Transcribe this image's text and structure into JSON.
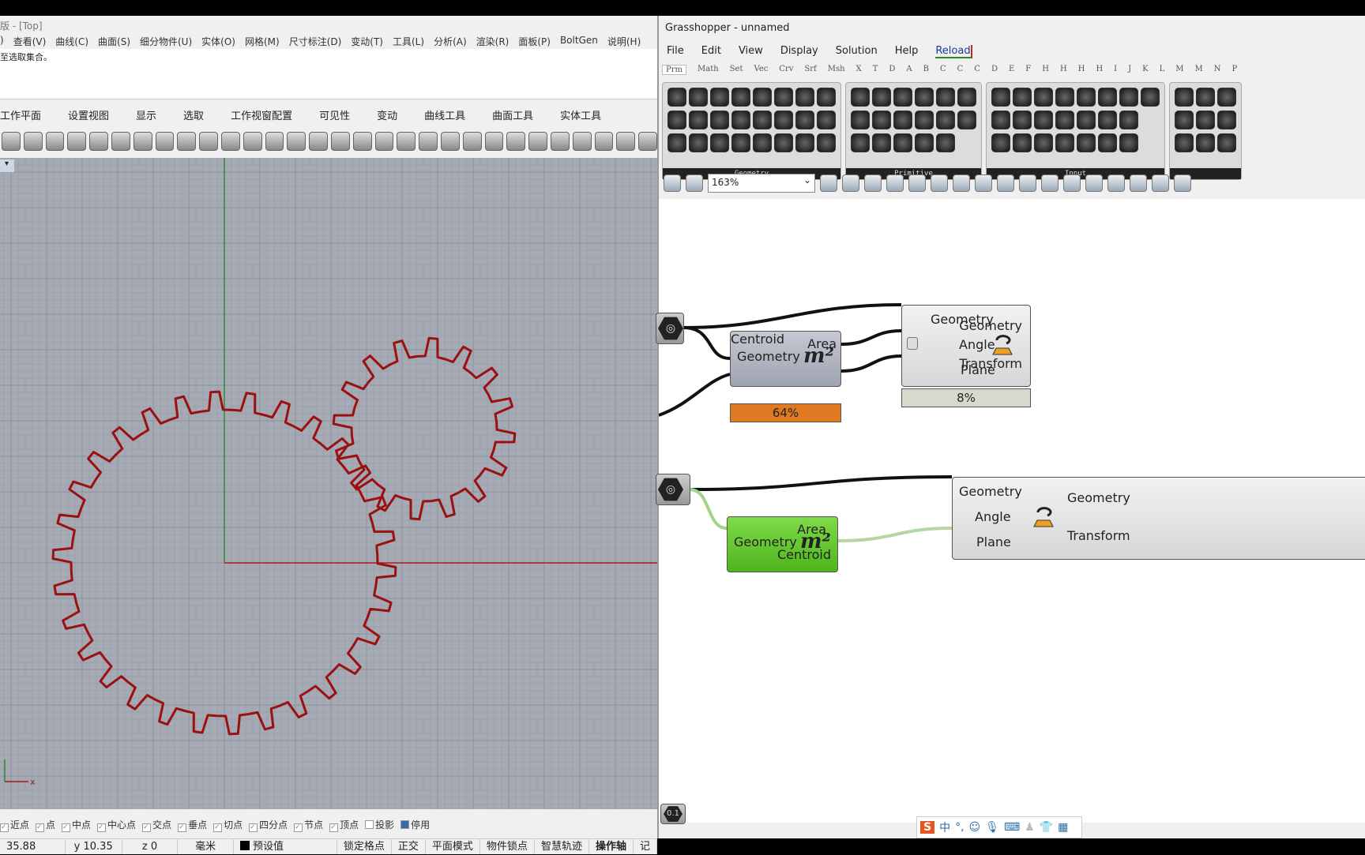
{
  "rhino": {
    "title": "版 - [Top]",
    "menu": [
      ")",
      "查看(V)",
      "曲线(C)",
      "曲面(S)",
      "细分物件(U)",
      "实体(O)",
      "网格(M)",
      "尺寸标注(D)",
      "变动(T)",
      "工具(L)",
      "分析(A)",
      "渲染(R)",
      "面板(P)",
      "BoltGen",
      "说明(H)"
    ],
    "command_text": "至选取集合。",
    "tabs": [
      "工作平面",
      "设置视图",
      "显示",
      "选取",
      "工作视窗配置",
      "可见性",
      "变动",
      "曲线工具",
      "曲面工具",
      "实体工具"
    ],
    "toolbar_icons": [
      "print-icon",
      "new-icon",
      "cut-icon",
      "copy-icon",
      "paste-icon",
      "undo-icon",
      "pan-icon",
      "rotate-view-icon",
      "zoom-icon",
      "zoom-window-icon",
      "zoom-extents-icon",
      "zoom-selected-icon",
      "rotate-icon",
      "four-viewports-icon",
      "car-icon",
      "grid-icon",
      "circle-icon",
      "points-icon",
      "light-icon",
      "lock-icon",
      "layer-icon",
      "color-wheel-icon",
      "sphere-icon",
      "shaded-sphere-icon",
      "render-sphere-icon",
      "cone-icon",
      "gear-icon",
      "dimension-icon",
      "globe-icon",
      "help-icon"
    ],
    "viewport_label": "▾",
    "axis_x": "x",
    "gear_teeth": {
      "large": 30,
      "small": 16
    },
    "curve_color": "#9b1010",
    "osnap": [
      {
        "label": "近点",
        "checked": true
      },
      {
        "label": "点",
        "checked": true
      },
      {
        "label": "中点",
        "checked": true
      },
      {
        "label": "中心点",
        "checked": true
      },
      {
        "label": "交点",
        "checked": true
      },
      {
        "label": "垂点",
        "checked": true
      },
      {
        "label": "切点",
        "checked": true
      },
      {
        "label": "四分点",
        "checked": true
      },
      {
        "label": "节点",
        "checked": true
      },
      {
        "label": "顶点",
        "checked": true
      },
      {
        "label": "投影",
        "checked": false
      },
      {
        "label": "停用",
        "checked": false
      }
    ],
    "status": {
      "x": "35.88",
      "y": "y 10.35",
      "z": "z 0",
      "units": "毫米",
      "layer": "预设值",
      "toggles": [
        "锁定格点",
        "正交",
        "平面模式",
        "物件锁点",
        "智慧轨迹",
        "操作轴",
        "记"
      ]
    }
  },
  "gh": {
    "title": "Grasshopper - unnamed",
    "menu": [
      "File",
      "Edit",
      "View",
      "Display",
      "Solution",
      "Help"
    ],
    "reload": "Reload",
    "tabs": [
      "Prm",
      "Math",
      "Set",
      "Vec",
      "Crv",
      "Srf",
      "Msh",
      "X",
      "T",
      "D",
      "A",
      "B",
      "C",
      "C",
      "C",
      "D",
      "E",
      "F",
      "H",
      "H",
      "H",
      "H",
      "I",
      "J",
      "K",
      "L",
      "M",
      "M",
      "N",
      "P"
    ],
    "groups": [
      {
        "label": "Geometry",
        "count": 24
      },
      {
        "label": "Primitive",
        "count": 17
      },
      {
        "label": "Input",
        "count": 22
      },
      {
        "label": "",
        "count": 9
      }
    ],
    "zoom": "163%",
    "canvas_toolbar_icons": [
      "open-icon",
      "save-icon",
      "zoom-extents-icon",
      "eye-icon",
      "sketch-icon",
      "cluster-icon",
      "gha-icon",
      "document-icon",
      "search-icon",
      "package-icon",
      "bulb-icon",
      "wire-icon",
      "delete-icon",
      "pointer-icon",
      "cross-icon",
      "circle-icon",
      "palette-icon",
      "calendar-icon",
      "disable-icon"
    ],
    "nodes": {
      "area1": {
        "inputs": [
          "Geometry"
        ],
        "outputs": [
          "Area",
          "Centroid"
        ],
        "progress": "64%",
        "color": "#a5a8b5",
        "bar_color": "#e07a22"
      },
      "rotate1": {
        "inputs": [
          "Geometry",
          "Angle",
          "Plane"
        ],
        "outputs": [
          "Geometry",
          "Transform"
        ],
        "progress": "8%"
      },
      "area2": {
        "inputs": [
          "Geometry"
        ],
        "outputs": [
          "Area",
          "Centroid"
        ],
        "color": "#5fc12a"
      },
      "rotate2": {
        "inputs": [
          "Geometry",
          "Angle",
          "Plane"
        ],
        "outputs": [
          "Geometry",
          "Transform"
        ]
      },
      "m2": "m²"
    },
    "bottom_icon": "0.1",
    "ime": [
      "中",
      "°,"
    ]
  }
}
